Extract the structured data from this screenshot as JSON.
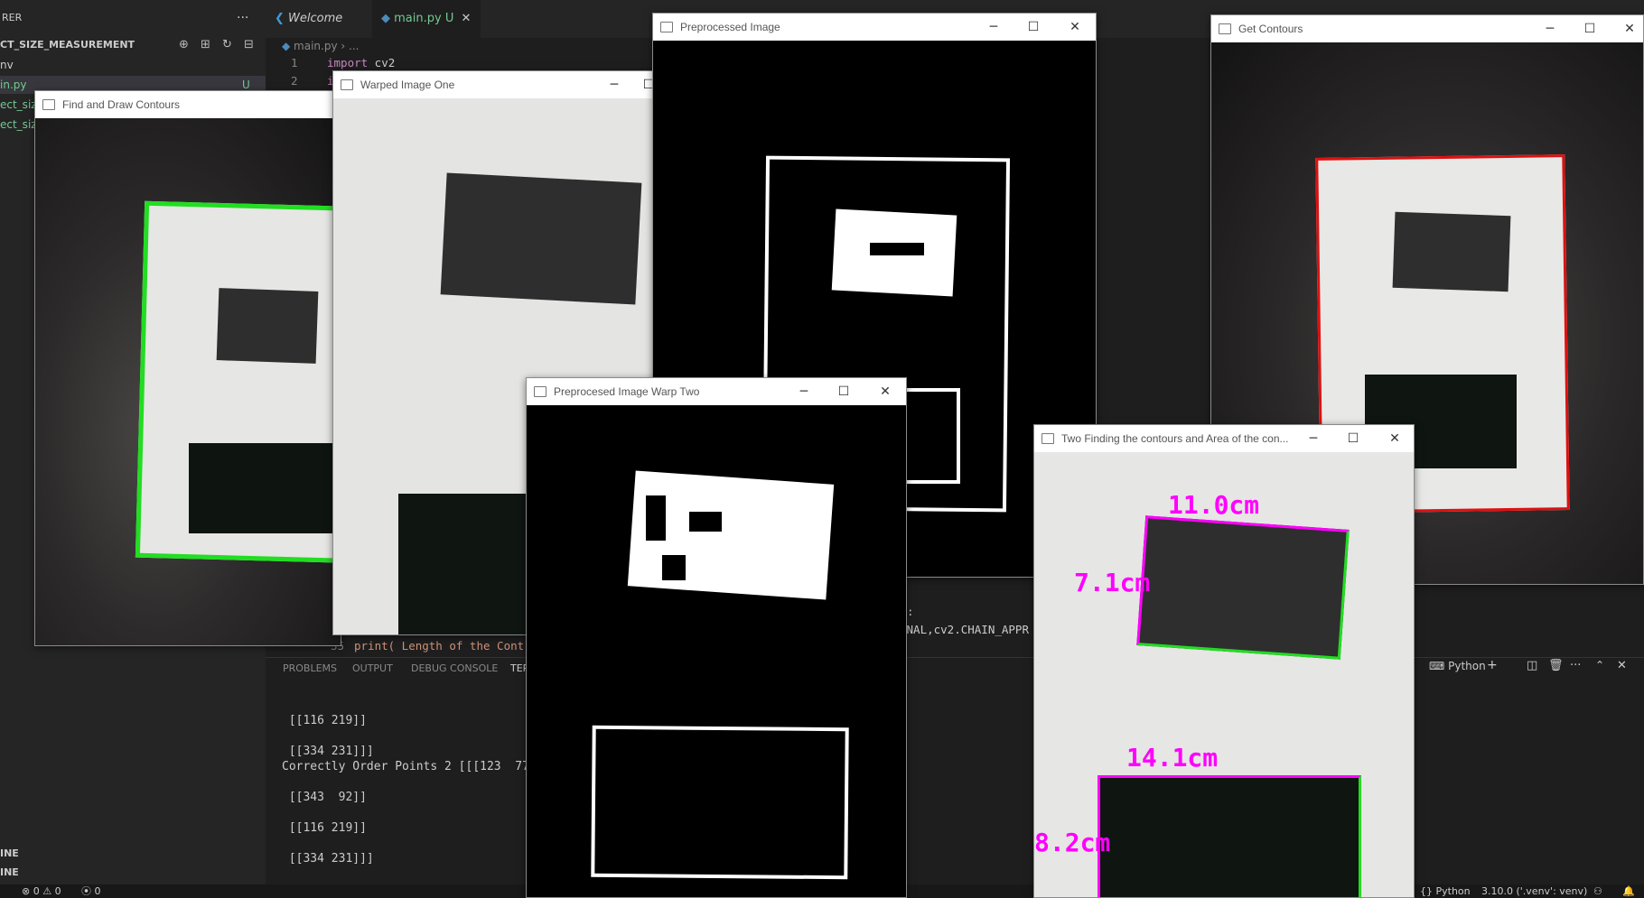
{
  "explorer": {
    "header": "RER",
    "more": "···",
    "project": "CT_SIZE_MEASUREMENT",
    "items": [
      "nv",
      "in.py",
      "ect_siz",
      "ect_siz"
    ],
    "main_badge": "U",
    "bottom_rows": [
      "INE",
      "INE"
    ]
  },
  "tabs": [
    {
      "label": "Welcome"
    },
    {
      "label": "main.py",
      "badge": "U",
      "close": "✕"
    }
  ],
  "breadcrumb": {
    "file": "main.py",
    "sep": "›",
    "rest": "..."
  },
  "code": {
    "line_numbers": [
      "1",
      "2"
    ],
    "line1_kw": "import",
    "line1_rest": " cv2",
    "line2_kw": "i",
    "line_35": "35",
    "line35_text": "print( Length of the Cont",
    "frag1": ":",
    "frag2": "RNAL,cv2.CHAIN_APPR"
  },
  "panel": {
    "tabs": [
      "PROBLEMS",
      "OUTPUT",
      "DEBUG CONSOLE",
      "TER"
    ],
    "python_label": "Python",
    "terminal_lines": [
      " [[116 219]]",
      "",
      " [[334 231]]]",
      "Correctly Order Points 2 [[[123  77]]",
      "",
      " [[343  92]]",
      "",
      " [[116 219]]",
      "",
      " [[334 231]]]"
    ]
  },
  "status": {
    "errors": "0",
    "warnings": "0",
    "ports": "0",
    "python": "Python",
    "version": "3.10.0 ('.venv': venv)"
  },
  "windows": {
    "w1": {
      "title": "Find and Draw Contours"
    },
    "w2": {
      "title": "Warped Image One"
    },
    "w3": {
      "title": "Preprocessed Image"
    },
    "w4": {
      "title": "Preprocesed Image Warp Two"
    },
    "w5": {
      "title": "Get Contours"
    },
    "w6": {
      "title": "Two Finding the contours and Area of the con..."
    }
  },
  "measurements": {
    "card_width": "11.0cm",
    "card_height": "7.1cm",
    "box_width": "14.1cm",
    "box_height": "8.2cm"
  },
  "colors": {
    "accent_magenta": "#ff00ff",
    "contour_green": "#22dd22",
    "contour_red": "#dd1111",
    "editor_bg": "#1e1e1e"
  },
  "icons": {
    "minimize": "─",
    "maximize": "☐",
    "close": "✕"
  }
}
